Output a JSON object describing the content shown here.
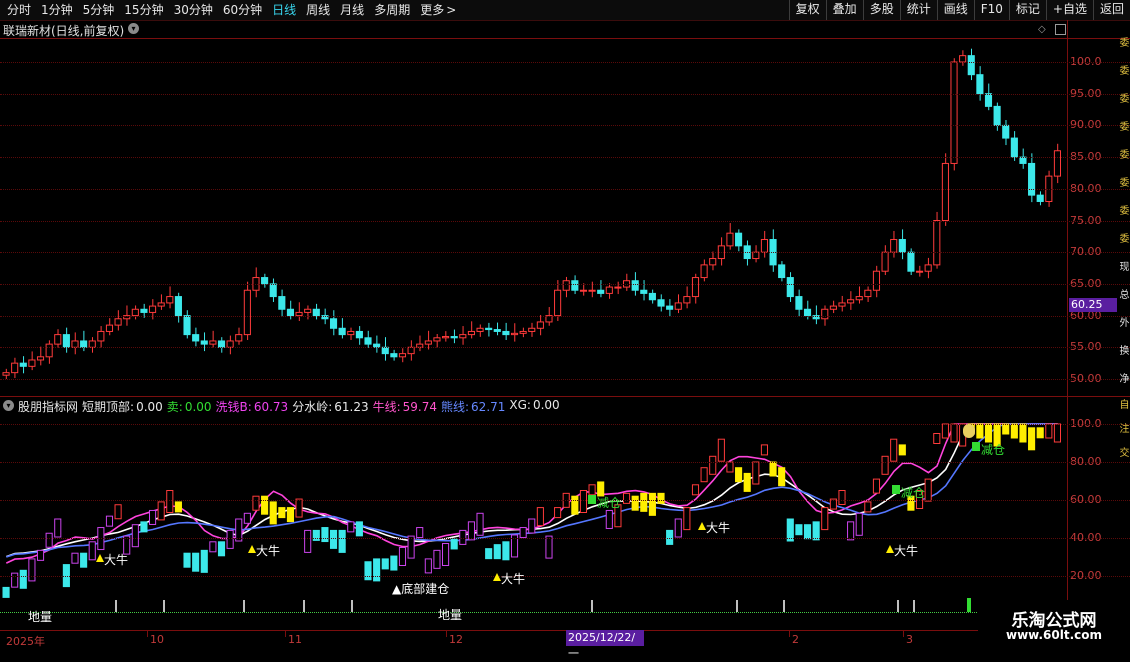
{
  "toolbar": {
    "periods": [
      "分时",
      "1分钟",
      "5分钟",
      "15分钟",
      "30分钟",
      "60分钟",
      "日线",
      "周线",
      "月线",
      "多周期",
      "更多"
    ],
    "active_period": "日线",
    "more_arrow": ">",
    "right_buttons": [
      "复权",
      "叠加",
      "多股",
      "统计",
      "画线",
      "F10",
      "标记",
      "+自选",
      "返回"
    ]
  },
  "stock": {
    "title": "联瑞新材(日线,前复权)",
    "dropdown_icon": "chevron-down-icon"
  },
  "price_axis": {
    "ticks": [
      "100.0",
      "95.00",
      "90.00",
      "85.00",
      "80.00",
      "75.00",
      "70.00",
      "65.00",
      "60.00",
      "55.00",
      "50.00"
    ],
    "current_price": "60.25"
  },
  "indicator": {
    "name": "股朋指标网",
    "fields": [
      {
        "label": "短期顶部:",
        "value": "0.00",
        "color": "#e8e8e8"
      },
      {
        "label": "卖:",
        "value": "0.00",
        "color": "#33dd33"
      },
      {
        "label": "洗钱B:",
        "value": "60.73",
        "color": "#ee44ee"
      },
      {
        "label": "分水岭:",
        "value": "61.23",
        "color": "#e8e8e8"
      },
      {
        "label": "牛线:",
        "value": "59.74",
        "color": "#ff55cc"
      },
      {
        "label": "熊线:",
        "value": "62.71",
        "color": "#6688ff"
      },
      {
        "label": "XG:",
        "value": "0.00",
        "color": "#e8e8e8"
      }
    ],
    "axis_ticks": [
      "100.0",
      "80.00",
      "60.00",
      "40.00",
      "20.00"
    ],
    "annotations": [
      {
        "text": "大牛",
        "color": "#ffffff"
      },
      {
        "text": "大牛",
        "color": "#ffffff"
      },
      {
        "text": "大牛",
        "color": "#ffffff"
      },
      {
        "text": "大牛",
        "color": "#ffffff"
      },
      {
        "text": "大牛",
        "color": "#ffffff"
      },
      {
        "text": "▲底部建仓",
        "color": "#ffffff"
      },
      {
        "text": "减仓",
        "color": "#33dd33"
      },
      {
        "text": "减仓",
        "color": "#33dd33"
      },
      {
        "text": "减仓",
        "color": "#33dd33"
      },
      {
        "text": "地量",
        "color": "#ffffff"
      },
      {
        "text": "地量",
        "color": "#ffffff"
      }
    ]
  },
  "right_edge_text": {
    "top": [
      "委",
      "委",
      "委",
      "委",
      "委",
      "委",
      "委",
      "委",
      "现",
      "总",
      "外",
      "换",
      "净"
    ],
    "bottom": [
      "自",
      "注",
      "交"
    ]
  },
  "date_axis": {
    "labels": [
      "2025年",
      "10",
      "11",
      "12",
      "2",
      "3"
    ],
    "cursor_date": "2025/12/22/一"
  },
  "watermark": {
    "title": "乐淘公式网",
    "url": "www.60lt.com"
  },
  "colors": {
    "up": "#ff3b3b",
    "down": "#3ce8ea",
    "grid": "#7a0e0e",
    "active_tab": "#39d7f0"
  }
}
